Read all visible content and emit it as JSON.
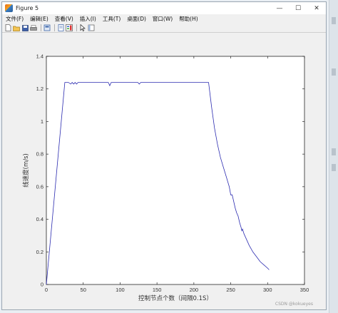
{
  "window": {
    "title": "Figure 5",
    "controls": {
      "minimize": "—",
      "maximize": "☐",
      "close": "✕"
    }
  },
  "menu": {
    "items": [
      "文件(F)",
      "编辑(E)",
      "查看(V)",
      "插入(I)",
      "工具(T)",
      "桌面(D)",
      "窗口(W)",
      "帮助(H)"
    ]
  },
  "toolbar": {
    "icons": [
      "new-figure-icon",
      "open-file-icon",
      "save-icon",
      "print-icon",
      "print-preview-icon",
      "link-icon",
      "colorbar-icon",
      "legend-icon",
      "pointer-icon",
      "property-editor-icon"
    ]
  },
  "chart_data": {
    "type": "line",
    "title": "",
    "xlabel": "控制节点个数（间隔0.1S）",
    "ylabel": "线速度(m/s)",
    "xlim": [
      0,
      350
    ],
    "ylim": [
      0,
      1.4
    ],
    "xticks": [
      0,
      50,
      100,
      150,
      200,
      250,
      300,
      350
    ],
    "yticks": [
      0,
      0.2,
      0.4,
      0.6,
      0.8,
      1,
      1.2,
      1.4
    ],
    "grid": false,
    "line_color": "#2b2bb0",
    "series": [
      {
        "x": [
          0,
          25,
          30,
          33,
          35,
          37,
          39,
          41,
          43,
          45,
          50,
          60,
          70,
          80,
          84,
          86,
          88,
          90,
          100,
          110,
          120,
          124,
          126,
          128,
          130,
          140,
          150,
          160,
          170,
          180,
          190,
          200,
          210,
          218,
          220,
          224,
          228,
          232,
          236,
          240,
          244,
          248,
          250,
          252,
          254,
          256,
          258,
          260,
          262,
          264,
          265,
          266,
          268,
          270,
          275,
          280,
          285,
          290,
          295,
          300,
          302
        ],
        "y": [
          0,
          1.24,
          1.24,
          1.23,
          1.24,
          1.23,
          1.24,
          1.23,
          1.24,
          1.24,
          1.24,
          1.24,
          1.24,
          1.24,
          1.24,
          1.22,
          1.24,
          1.24,
          1.24,
          1.24,
          1.24,
          1.24,
          1.23,
          1.24,
          1.24,
          1.24,
          1.24,
          1.24,
          1.24,
          1.24,
          1.24,
          1.24,
          1.24,
          1.24,
          1.24,
          1.09,
          0.96,
          0.86,
          0.78,
          0.72,
          0.66,
          0.6,
          0.55,
          0.55,
          0.51,
          0.47,
          0.44,
          0.42,
          0.38,
          0.35,
          0.33,
          0.34,
          0.31,
          0.29,
          0.24,
          0.2,
          0.17,
          0.14,
          0.12,
          0.1,
          0.09
        ]
      }
    ]
  },
  "watermark": "CSDN @kokueyes"
}
